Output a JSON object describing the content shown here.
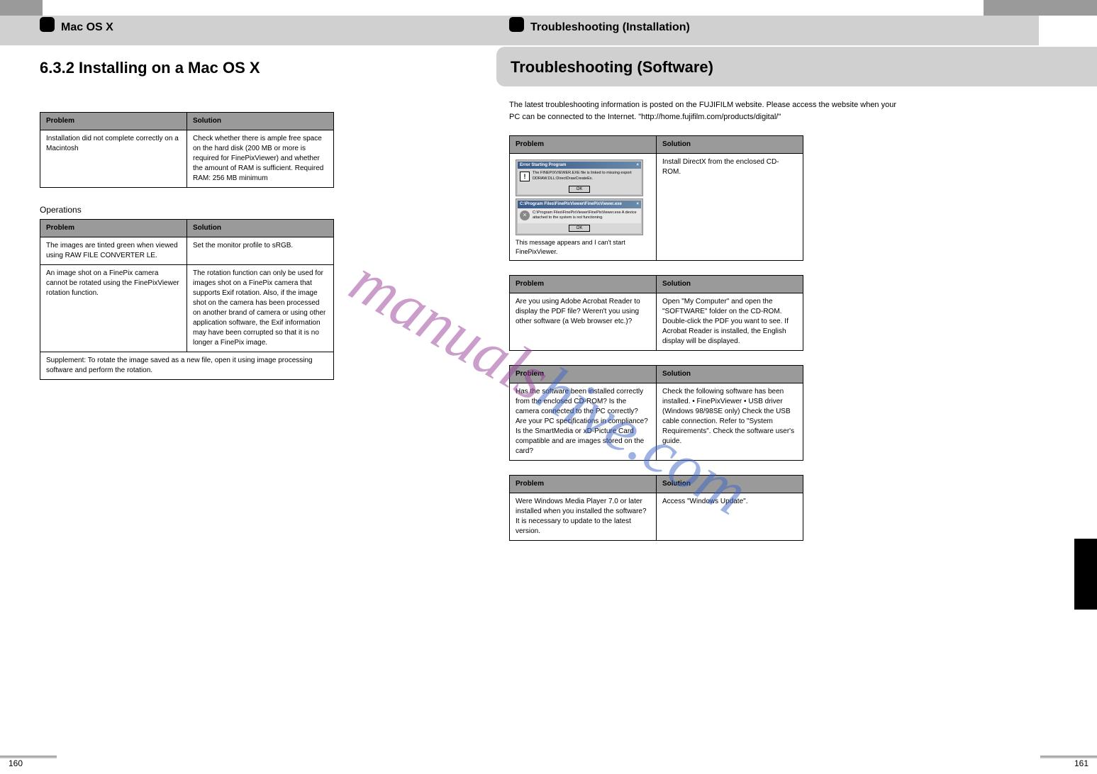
{
  "leftPage": {
    "sectionTitle": "Mac OS X",
    "subtitle": "6.3.2 Installing on a Mac OS X",
    "intro1": "",
    "table1": {
      "headers": [
        "Problem",
        "Solution"
      ],
      "rows": [
        {
          "problem": "Installation did not complete correctly on a Macintosh",
          "solution": "Check whether there is ample free space on the hard disk (200 MB or more is required for FinePixViewer) and whether the amount of RAM is sufficient.\nRequired RAM: 256 MB minimum"
        }
      ]
    },
    "heading2": "Operations",
    "table2": {
      "headers": [
        "Problem",
        "Solution"
      ],
      "rows": [
        {
          "problem": "The images are tinted green when viewed using RAW FILE CONVERTER LE.",
          "solution": "Set the monitor profile to sRGB."
        },
        {
          "problem": "An image shot on a FinePix camera cannot be rotated using the FinePixViewer rotation function.",
          "solution": "The rotation function can only be used for images shot on a FinePix camera that supports Exif rotation. Also, if the image shot on the camera has been processed on another brand of camera or using other application software, the Exif information may have been corrupted so that it is no longer a FinePix image."
        },
        {
          "problem": "Supplement: To rotate the image saved as a new file, open it using image processing software and perform the rotation.",
          "solution": ""
        }
      ]
    },
    "pageNumber": "160"
  },
  "rightPage": {
    "sectionTitle": "Troubleshooting (Installation)",
    "subtitle": "Troubleshooting (Software)",
    "intro": "The latest troubleshooting information is posted on the FUJIFILM website. Please access the website when your PC can be connected to the Internet.\n\"http://home.fujifilm.com/products/digital/\"",
    "table1": {
      "headers": [
        "Problem",
        "Solution"
      ],
      "rows": [
        {
          "problem_dialogs": {
            "d1_title": "Error Starting Program",
            "d1_text": "The FINEPIXVIEWER.EXE file is linked to missing export DDRAW.DLL:DirectDrawCreateEx.",
            "d1_btn": "OK",
            "d2_title": "C:\\Program Files\\FinePixViewer\\FinePixViewer.exe",
            "d2_text": "C:\\Program Files\\FinePixViewer\\FinePixViewer.exe\nA device attached to the system is not functioning.",
            "d2_btn": "OK"
          },
          "problem_caption": "This message appears and I can't start FinePixViewer.",
          "solution": "Install DirectX from the enclosed CD-ROM."
        }
      ]
    },
    "table2": {
      "headers": [
        "Problem",
        "Solution"
      ],
      "rows": [
        {
          "problem": "Are you using Adobe Acrobat Reader to display the PDF file? Weren't you using other software (a Web browser etc.)?",
          "solution": "Open \"My Computer\" and open the \"SOFTWARE\" folder on the CD-ROM. Double-click the PDF you want to see. If Acrobat Reader is installed, the English display will be displayed."
        }
      ]
    },
    "table3": {
      "headers": [
        "Problem",
        "Solution"
      ],
      "rows": [
        {
          "problem": "Has the software been installed correctly from the enclosed CD-ROM?\nIs the camera connected to the PC correctly?\nAre your PC specifications in compliance?\nIs the SmartMedia or xD-Picture Card compatible and are images stored on the card?",
          "solution": "Check the following software has been installed.\n• FinePixViewer\n• USB driver (Windows 98/98SE only)\nCheck the USB cable connection.\nRefer to \"System Requirements\".\nCheck the software user's guide."
        }
      ]
    },
    "table4": {
      "headers": [
        "Problem",
        "Solution"
      ],
      "rows": [
        {
          "problem": "Were Windows Media Player 7.0 or later installed when you installed the software? It is necessary to update to the latest version.",
          "solution": "Access \"Windows Update\"."
        }
      ]
    },
    "pageNumber": "161"
  },
  "watermark": {
    "text1": "manuals",
    "text2": "hive.com"
  }
}
